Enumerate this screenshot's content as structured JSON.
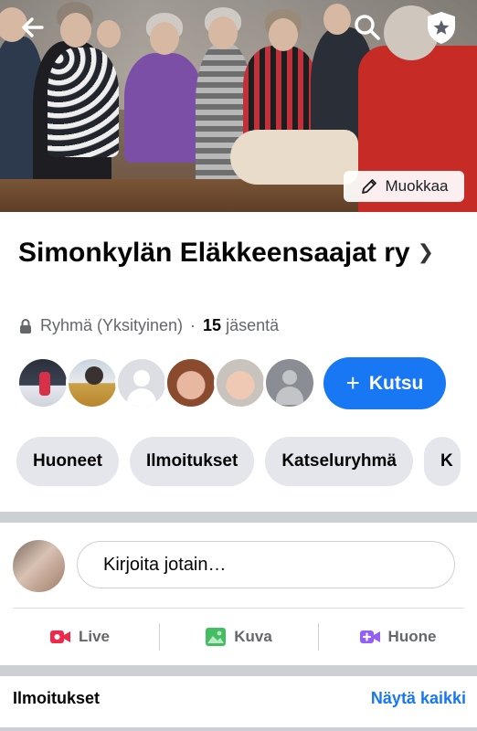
{
  "cover": {
    "edit_label": "Muokkaa"
  },
  "group": {
    "title": "Simonkylän Eläkkeensaajat ry",
    "privacy": "Ryhmä (Yksityinen)",
    "separator": "·",
    "member_count": "15",
    "member_word": "jäsentä"
  },
  "members": {
    "invite_label": "Kutsu",
    "invite_prefix": "+"
  },
  "tabs": [
    {
      "label": "Huoneet"
    },
    {
      "label": "Ilmoitukset"
    },
    {
      "label": "Katseluryhmä"
    },
    {
      "label": "K"
    }
  ],
  "composer": {
    "placeholder": "Kirjoita jotain…"
  },
  "actions": [
    {
      "label": "Live",
      "icon": "live-video-icon",
      "color": "#f02849"
    },
    {
      "label": "Kuva",
      "icon": "photo-icon",
      "color": "#45bd62"
    },
    {
      "label": "Huone",
      "icon": "room-video-icon",
      "color": "#9360f7"
    }
  ],
  "announcements": {
    "heading": "Ilmoitukset",
    "see_all": "Näytä kaikki"
  },
  "colors": {
    "accent": "#1877f2",
    "tab_bg": "#e4e6eb",
    "secondary_text": "#65676b"
  }
}
